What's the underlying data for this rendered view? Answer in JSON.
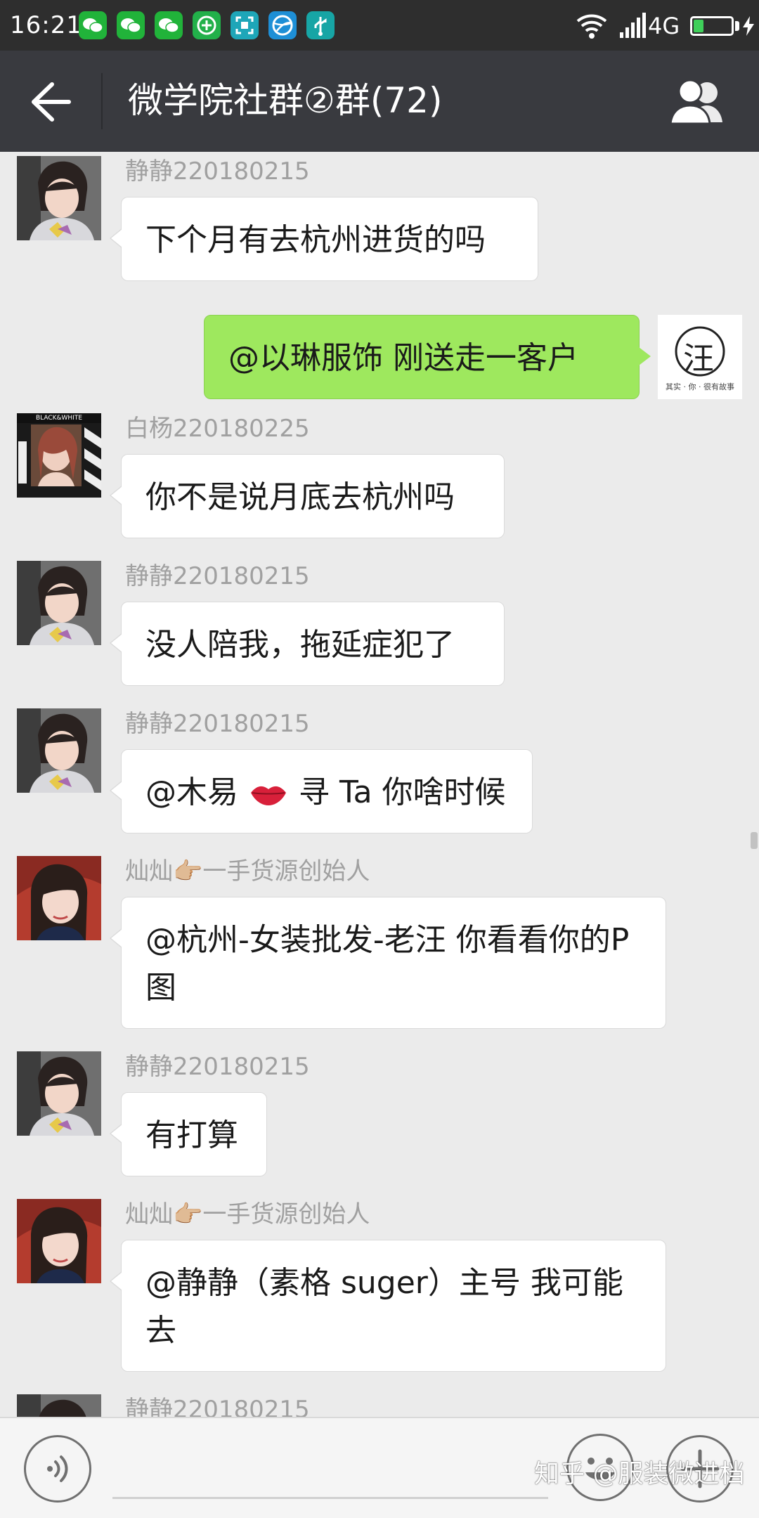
{
  "status_bar": {
    "time": "16:21",
    "network": "4G",
    "notification_icons": [
      "wechat-icon",
      "wechat-icon",
      "wechat-icon",
      "add-circle-icon",
      "scan-icon",
      "ball-icon",
      "usb-icon"
    ],
    "battery_level": 0.25
  },
  "header": {
    "title": "微学院社群②群(72)",
    "back_icon": "back-arrow-icon",
    "members_icon": "group-members-icon"
  },
  "messages": [
    {
      "sender": "静静220180215",
      "text": "下个月有去杭州进货的吗",
      "side": "left",
      "avatar": "jingjing"
    },
    {
      "sender": "",
      "text": "@以琳服饰  刚送走一客户",
      "side": "right",
      "avatar": "wang-logo"
    },
    {
      "sender": "白杨220180225",
      "text": "你不是说月底去杭州吗",
      "side": "left",
      "avatar": "baiyang"
    },
    {
      "sender": "静静220180215",
      "text": "没人陪我，拖延症犯了",
      "side": "left",
      "avatar": "jingjing"
    },
    {
      "sender": "静静220180215",
      "text_before": "@木易",
      "text_after": "寻 Ta  你啥时候",
      "emoji": "kiss-lips-emoji",
      "side": "left",
      "avatar": "jingjing"
    },
    {
      "sender": "灿灿👉🏼一手货源创始人",
      "text": "@杭州-女装批发-老汪  你看看你的P图",
      "side": "left",
      "avatar": "cancan"
    },
    {
      "sender": "静静220180215",
      "text": "有打算",
      "side": "left",
      "avatar": "jingjing"
    },
    {
      "sender": "灿灿👉🏼一手货源创始人",
      "text": "@静静（素格 suger）主号  我可能去",
      "side": "left",
      "avatar": "cancan"
    },
    {
      "sender": "静静220180215",
      "text": "",
      "side": "left",
      "avatar": "jingjing"
    }
  ],
  "logo_text": {
    "wang_char": "汪",
    "wang_caption": "其实 · 你 · 很有故事",
    "baiyang_banner": "BLACK&WHITE"
  },
  "input_bar": {
    "voice_icon": "voice-icon",
    "emoji_icon": "emoji-icon",
    "more_icon": "plus-icon",
    "watermark": "知乎 @服装微进档"
  },
  "colors": {
    "status_bar": "#2e2e2e",
    "title_bar": "#393a3f",
    "chat_bg": "#ebebeb",
    "bubble_self": "#9ee85e",
    "bubble_other": "#ffffff"
  }
}
